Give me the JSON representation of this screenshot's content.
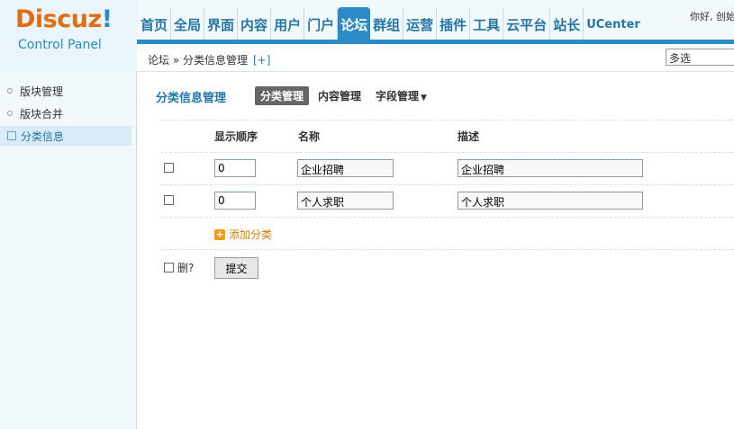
{
  "logo": {
    "brand": "Discuz",
    "bang": "!",
    "subtitle": "Control Panel"
  },
  "topnav": {
    "items": [
      "首页",
      "全局",
      "界面",
      "内容",
      "用户",
      "门户",
      "论坛",
      "群组",
      "运营",
      "插件",
      "工具",
      "云平台",
      "站长",
      "UCenter"
    ],
    "active_index": 6
  },
  "greeting": "你好, 创始",
  "breadcrumb": {
    "path": "论坛 » 分类信息管理",
    "plus": "[+]"
  },
  "multi_select": "多选",
  "sidebar": {
    "items": [
      {
        "label": "版块管理",
        "icon": "dot-icon"
      },
      {
        "label": "版块合并",
        "icon": "dot-icon"
      },
      {
        "label": "分类信息",
        "icon": "external-link-icon",
        "active": true
      }
    ]
  },
  "main": {
    "title": "分类信息管理",
    "tabs": [
      {
        "label": "分类管理",
        "active": true
      },
      {
        "label": "内容管理"
      },
      {
        "label": "字段管理",
        "dropdown": true
      }
    ],
    "columns": [
      "显示顺序",
      "名称",
      "描述"
    ],
    "rows": [
      {
        "order": "0",
        "name": "企业招聘",
        "desc": "企业招聘"
      },
      {
        "order": "0",
        "name": "个人求职",
        "desc": "个人求职"
      }
    ],
    "add_label": "添加分类",
    "delete_label": "删?",
    "submit_label": "提交"
  },
  "colors": {
    "accent": "#2a8bc6",
    "brand_orange": "#e06e12",
    "add_orange": "#f39a1c"
  }
}
